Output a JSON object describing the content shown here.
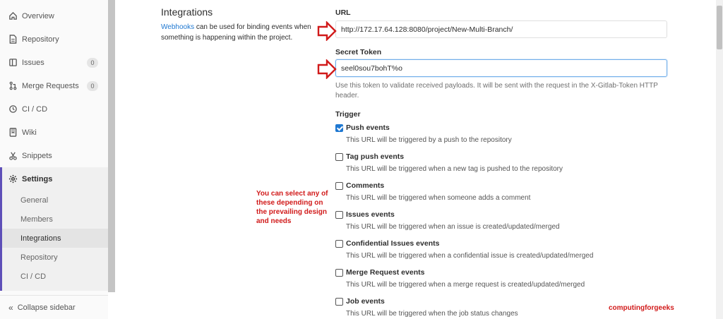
{
  "sidebar": {
    "items": [
      {
        "label": "Overview",
        "icon": "home-icon"
      },
      {
        "label": "Repository",
        "icon": "doc-icon"
      },
      {
        "label": "Issues",
        "icon": "issues-icon",
        "count": "0"
      },
      {
        "label": "Merge Requests",
        "icon": "merge-icon",
        "count": "0"
      },
      {
        "label": "CI / CD",
        "icon": "rocket-icon"
      },
      {
        "label": "Wiki",
        "icon": "book-icon"
      },
      {
        "label": "Snippets",
        "icon": "scissors-icon"
      }
    ],
    "settings": {
      "label": "Settings",
      "icon": "gear-icon",
      "subitems": [
        {
          "label": "General"
        },
        {
          "label": "Members"
        },
        {
          "label": "Integrations",
          "active": true
        },
        {
          "label": "Repository"
        },
        {
          "label": "CI / CD"
        }
      ]
    },
    "collapse_label": "Collapse sidebar"
  },
  "integrations": {
    "title": "Integrations",
    "desc_link": "Webhooks",
    "desc_rest_line1": " can be used for binding events when",
    "desc_line2": "something is happening within the project."
  },
  "form": {
    "url_label": "URL",
    "url_value": "http://172.17.64.128:8080/project/New-Multi-Branch/",
    "token_label": "Secret Token",
    "token_value": "seel0sou7bohT%o",
    "token_help": "Use this token to validate received payloads. It will be sent with the request in the X-Gitlab-Token HTTP header.",
    "trigger_label": "Trigger",
    "triggers": [
      {
        "name": "Push events",
        "desc": "This URL will be triggered by a push to the repository",
        "checked": true
      },
      {
        "name": "Tag push events",
        "desc": "This URL will be triggered when a new tag is pushed to the repository",
        "checked": false
      },
      {
        "name": "Comments",
        "desc": "This URL will be triggered when someone adds a comment",
        "checked": false
      },
      {
        "name": "Issues events",
        "desc": "This URL will be triggered when an issue is created/updated/merged",
        "checked": false
      },
      {
        "name": "Confidential Issues events",
        "desc": "This URL will be triggered when a confidential issue is created/updated/merged",
        "checked": false
      },
      {
        "name": "Merge Request events",
        "desc": "This URL will be triggered when a merge request is created/updated/merged",
        "checked": false
      },
      {
        "name": "Job events",
        "desc": "This URL will be triggered when the job status changes",
        "checked": false
      }
    ]
  },
  "annotation": "You can select any of these depending on the prevailing design and needs",
  "watermark": "computingforgeeks",
  "colors": {
    "accent": "#1f78d1",
    "annotation_red": "#d11a1a",
    "settings_bar": "#5e4fb8"
  }
}
